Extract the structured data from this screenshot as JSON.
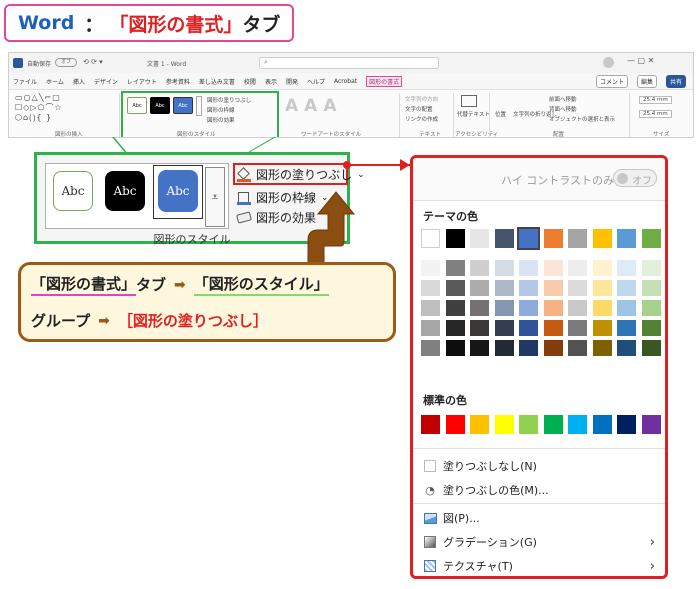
{
  "title": {
    "app": "Word",
    "colon": "：",
    "tab": "「図形の書式」",
    "suffix": "タブ"
  },
  "ribbon": {
    "window_title": "文書 1 - Word",
    "autosave_label": "自動保存",
    "autosave_state": "オフ",
    "comment_btn": "コメント",
    "edit_btn": "編集",
    "share_btn": "共有",
    "menu_tabs": [
      "ファイル",
      "ホーム",
      "挿入",
      "デザイン",
      "レイアウト",
      "参考資料",
      "差し込み文書",
      "校閲",
      "表示",
      "開発",
      "ヘルプ",
      "Acrobat",
      "図形の書式"
    ],
    "groups": {
      "insert_shapes": "図形の挿入",
      "shape_styles": "図形のスタイル",
      "wordart_styles": "ワードアートのスタイル",
      "text": "テキスト",
      "accessibility": "アクセシビリティ",
      "arrange": "配置",
      "size": "サイズ"
    },
    "fill_cmd": "図形の塗りつぶし",
    "outline_cmd": "図形の枠線",
    "effect_cmd": "図形の効果",
    "text_direction": "文字列の方向",
    "text_align": "文字の配置",
    "create_link": "リンクの作成",
    "alt_text": "代替テキスト",
    "position": "位置",
    "wrap_text": "文字列の折り返し",
    "bring_forward": "前面へ移動",
    "send_backward": "背面へ移動",
    "selection_pane": "オブジェクトの選択と表示",
    "height": "25.4 mm",
    "width": "25.4 mm",
    "swatch_text": "Abc"
  },
  "zoom": {
    "swatch_text": "Abc",
    "fill_cmd": "図形の塗りつぶし",
    "outline_cmd": "図形の枠線",
    "effect_cmd": "図形の効果",
    "group_label": "図形のスタイル",
    "fill_arrow": "⌄",
    "outline_arrow": "⌄"
  },
  "info": {
    "line1_a": "「図形の書式」",
    "line1_b": "タブ",
    "line1_arrow": "➡",
    "line1_c": "「図形のスタイル」",
    "line2_a": "グループ",
    "line2_arrow": "➡",
    "line2_b": "［図形の塗りつぶし］"
  },
  "dropdown": {
    "high_contrast": "ハイ コントラストのみ(H)",
    "toggle_state": "オフ",
    "theme_header": "テーマの色",
    "standard_header": "標準の色",
    "no_fill": "塗りつぶしなし(N)",
    "more_colors": "塗りつぶしの色(M)...",
    "picture": "図(P)...",
    "gradient": "グラデーション(G)",
    "texture": "テクスチャ(T)",
    "theme_top": [
      "#ffffff",
      "#000000",
      "#e7e6e6",
      "#44546a",
      "#4472c4",
      "#ed7d31",
      "#a5a5a5",
      "#ffc000",
      "#5b9bd5",
      "#70ad47"
    ],
    "theme_shades": [
      [
        "#f2f2f2",
        "#d9d9d9",
        "#bfbfbf",
        "#a6a6a6",
        "#808080"
      ],
      [
        "#808080",
        "#595959",
        "#404040",
        "#262626",
        "#0d0d0d"
      ],
      [
        "#d0cece",
        "#aeabab",
        "#757171",
        "#3b3838",
        "#161616"
      ],
      [
        "#d6dce5",
        "#adb9ca",
        "#8497b0",
        "#333f50",
        "#222a35"
      ],
      [
        "#dae3f3",
        "#b4c7e7",
        "#8faadc",
        "#2f5597",
        "#1f3864"
      ],
      [
        "#fbe5d6",
        "#f8cbad",
        "#f4b183",
        "#c55a11",
        "#843c0c"
      ],
      [
        "#ededed",
        "#dbdbdb",
        "#c9c9c9",
        "#7b7b7b",
        "#525252"
      ],
      [
        "#fff2cc",
        "#ffe699",
        "#ffd966",
        "#bf9000",
        "#7f6000"
      ],
      [
        "#deebf7",
        "#bdd7ee",
        "#9dc3e6",
        "#2e75b6",
        "#1f4e79"
      ],
      [
        "#e2f0d9",
        "#c5e0b4",
        "#a9d18e",
        "#548235",
        "#385723"
      ]
    ],
    "standard": [
      "#c00000",
      "#ff0000",
      "#ffc000",
      "#ffff00",
      "#92d050",
      "#00b050",
      "#00b0f0",
      "#0070c0",
      "#002060",
      "#7030a0"
    ],
    "selected_theme_index": 4
  }
}
